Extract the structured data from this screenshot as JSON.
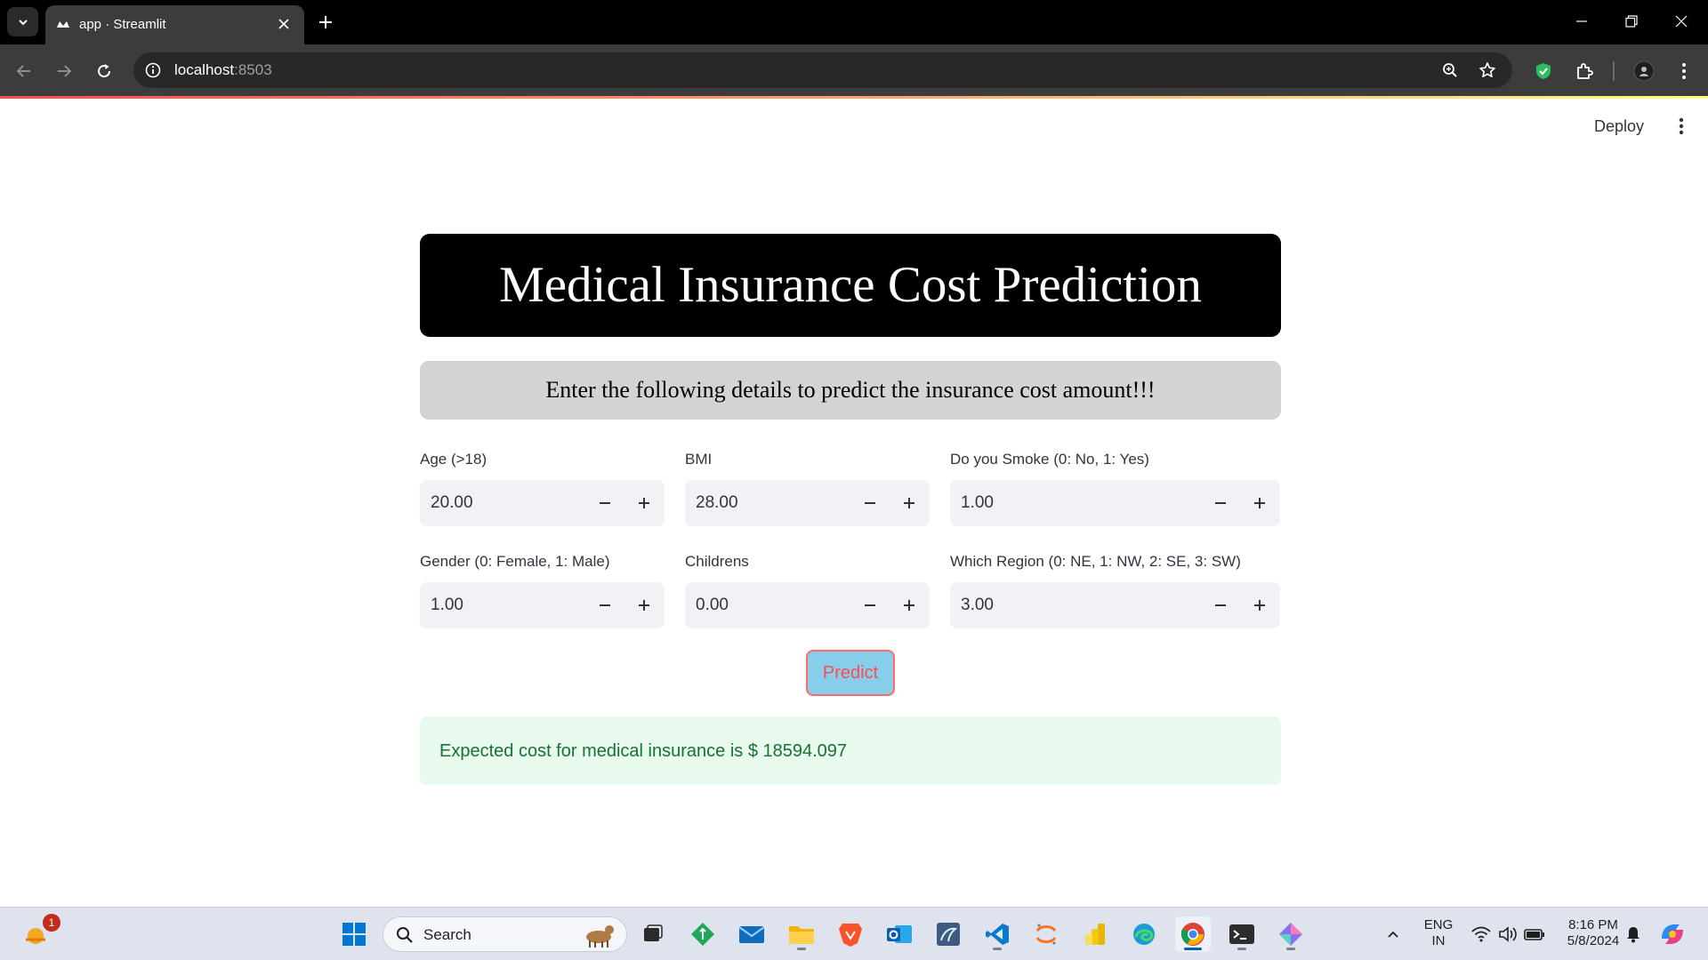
{
  "browser": {
    "tab_title": "app · Streamlit",
    "url_host": "localhost",
    "url_port": ":8503"
  },
  "header": {
    "deploy_label": "Deploy"
  },
  "main": {
    "title": "Medical Insurance Cost Prediction",
    "subtitle": "Enter the following details to predict the insurance cost amount!!!",
    "fields": [
      {
        "label": "Age (>18)",
        "value": "20.00"
      },
      {
        "label": "BMI",
        "value": "28.00"
      },
      {
        "label": "Do you Smoke (0: No, 1: Yes)",
        "value": "1.00"
      },
      {
        "label": "Gender (0: Female, 1: Male)",
        "value": "1.00"
      },
      {
        "label": "Childrens",
        "value": "0.00"
      },
      {
        "label": "Which Region (0: NE, 1: NW, 2: SE, 3: SW)",
        "value": "3.00"
      }
    ],
    "predict_label": "Predict",
    "result": "Expected cost for medical insurance is $ 18594.097"
  },
  "taskbar": {
    "search_label": "Search",
    "widget_badge": "1",
    "lang_top": "ENG",
    "lang_bottom": "IN",
    "time": "8:16 PM",
    "date": "5/8/2024"
  },
  "colors": {
    "title_bg": "#000000",
    "subtitle_bg": "#d3d3d3",
    "predict_bg": "#87ceeb",
    "predict_text": "#ff4b4b",
    "success_bg": "#e8f9ee",
    "success_text": "#177233"
  }
}
